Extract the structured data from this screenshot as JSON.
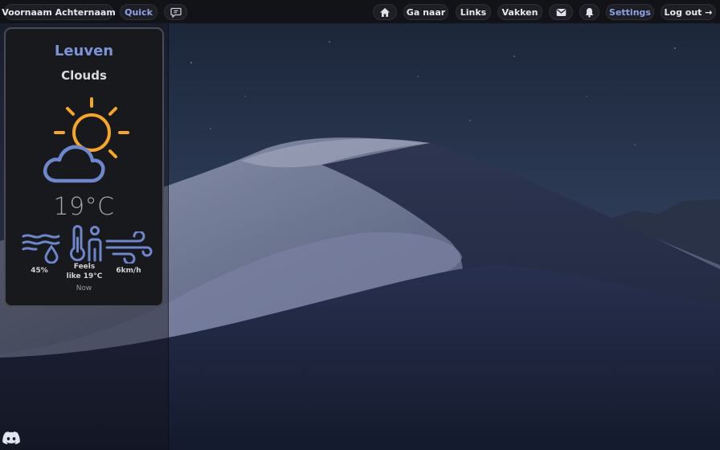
{
  "topbar": {
    "user_name": "Voornaam Achternaam",
    "quick_label": "Quick",
    "feedback_icon": "chat-icon",
    "home_icon": "home-icon",
    "goto_label": "Ga naar",
    "links_label": "Links",
    "courses_label": "Vakken",
    "mail_icon": "mail-icon",
    "notifications_icon": "bell-icon",
    "settings_label": "Settings",
    "logout_label": "Log out →"
  },
  "weather": {
    "city": "Leuven",
    "condition": "Clouds",
    "condition_icon": "sun-cloud-icon",
    "temperature": "19°C",
    "humidity": "45%",
    "feels_like_line1": "Feels",
    "feels_like_line2": "like 19°C",
    "wind": "6km/h",
    "time_label": "Now"
  },
  "bottom": {
    "discord_icon": "discord-icon"
  },
  "colors": {
    "accent": "#7d93d8",
    "sun": "#f4a52a",
    "icon_blue": "#6e86cc",
    "card_bg": "#18191c"
  }
}
